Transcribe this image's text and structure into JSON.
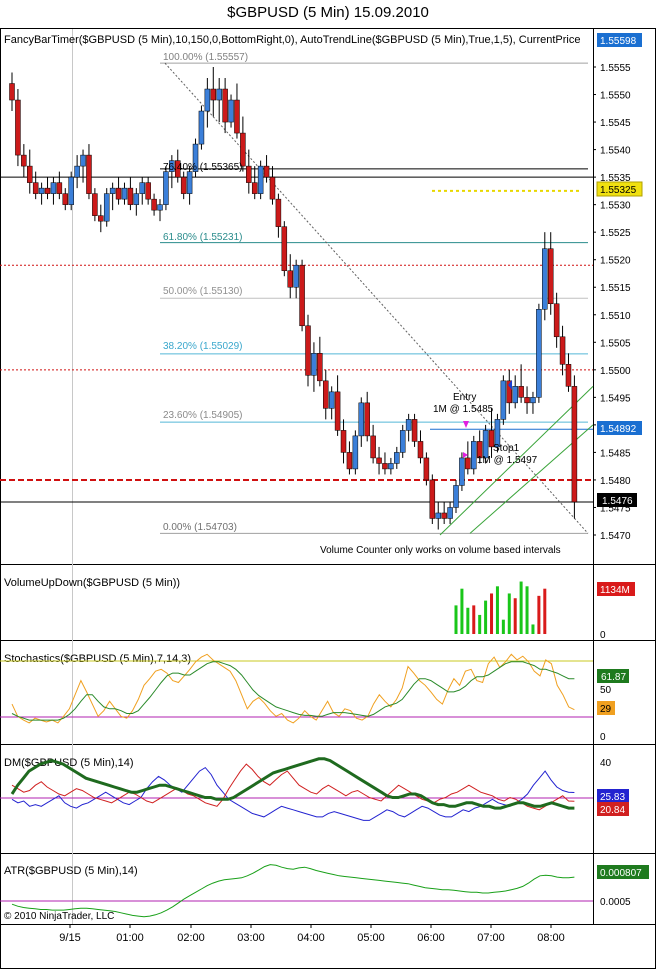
{
  "window": {
    "title": "$GBPUSD (5 Min)  15.09.2010"
  },
  "colors": {
    "up_candle": "#3b7fd9",
    "down_candle": "#cc1a1a",
    "wick": "#000000",
    "fib_gray": "#a0a0a0",
    "fib_teal": "#2a8c8c",
    "fib_blue": "#55b6d6",
    "red_level": "#d01010",
    "current_price_box": "#1a6fd1",
    "stop_box": "#000000",
    "target_box": "#f0e010",
    "volume_up": "#19c619",
    "volume_down": "#d91a1a",
    "stoch_k": "#f0a020",
    "stoch_d": "#2a8a2a",
    "dm_plus": "#2323d0",
    "dm_minus": "#d02020",
    "adx": "#1f7a1f",
    "atr": "#19a019"
  },
  "panels": {
    "price": {
      "header": "FancyBarTimer($GBPUSD (5 Min),10,150,0,BottomRight,0), AutoTrendLine($GBPUSD (5 Min),True,1,5), CurrentPrice",
      "yticks": [
        "1.5555",
        "1.5550",
        "1.5545",
        "1.5540",
        "1.5535",
        "1.5530",
        "1.5525",
        "1.5520",
        "1.5515",
        "1.5510",
        "1.5505",
        "1.5500",
        "1.5495",
        "1.5490",
        "1.5485",
        "1.5480",
        "1.5475",
        "1.5470"
      ],
      "fib_labels": [
        "100.00% (1.55557)",
        "76.40% (1.55365)",
        "61.80% (1.55231)",
        "50.00% (1.55130)",
        "38.20% (1.55029)",
        "23.60% (1.54905)",
        "0.00% (1.54703)"
      ],
      "price_boxes": [
        "1.55598",
        "1.55325",
        "1.54892",
        "1.5476"
      ],
      "entry_label": "Entry",
      "entry_detail": "1M @ 1.5485",
      "stop_label": "Stop1",
      "stop_detail": "1M @ 1.5497",
      "volume_note": "Volume Counter only works on volume based intervals"
    },
    "volume": {
      "header": "VolumeUpDown($GBPUSD (5 Min))",
      "box": "1134M",
      "yticks": [
        "0"
      ]
    },
    "stochastics": {
      "header": "Stochastics($GBPUSD (5 Min),7,14,3)",
      "box_d": "61.87",
      "box_k": "29",
      "yticks": [
        "50",
        "0"
      ]
    },
    "dm": {
      "header": "DM($GBPUSD (5 Min),14)",
      "box_plus": "25.83",
      "box_minus": "20.84",
      "yticks": [
        "40",
        "20"
      ]
    },
    "atr": {
      "header": "ATR($GBPUSD (5 Min),14)",
      "box": "0.000807",
      "yticks": [
        "0.0005"
      ],
      "copyright": "© 2010 NinjaTrader, LLC"
    }
  },
  "x_axis": {
    "labels": [
      "9/15",
      "01:00",
      "02:00",
      "03:00",
      "04:00",
      "05:00",
      "06:00",
      "07:00",
      "08:00"
    ]
  },
  "chart_data": {
    "type": "candlestick",
    "title": "$GBPUSD (5 Min)  15.09.2010",
    "x": [
      "9/15",
      "01:00",
      "02:00",
      "03:00",
      "04:00",
      "05:00",
      "06:00",
      "07:00",
      "08:00"
    ],
    "ylim": [
      1.5467,
      1.556
    ],
    "grid": false,
    "candles": [
      [
        1.5552,
        1.5554,
        1.5547,
        1.5549
      ],
      [
        1.5549,
        1.5551,
        1.5537,
        1.5539
      ],
      [
        1.5539,
        1.5541,
        1.5535,
        1.5537
      ],
      [
        1.5537,
        1.554,
        1.5532,
        1.5534
      ],
      [
        1.5534,
        1.5536,
        1.5531,
        1.5532
      ],
      [
        1.5532,
        1.5534,
        1.553,
        1.5533
      ],
      [
        1.5533,
        1.5535,
        1.5531,
        1.5532
      ],
      [
        1.5532,
        1.5535,
        1.553,
        1.5534
      ],
      [
        1.5534,
        1.5536,
        1.5531,
        1.5532
      ],
      [
        1.5532,
        1.5533,
        1.5529,
        1.553
      ],
      [
        1.553,
        1.5536,
        1.5529,
        1.5535
      ],
      [
        1.5535,
        1.5539,
        1.5533,
        1.5537
      ],
      [
        1.5537,
        1.554,
        1.5534,
        1.5539
      ],
      [
        1.5539,
        1.5541,
        1.5531,
        1.5532
      ],
      [
        1.5532,
        1.5533,
        1.5527,
        1.5528
      ],
      [
        1.5528,
        1.553,
        1.5525,
        1.5527
      ],
      [
        1.5527,
        1.5533,
        1.5526,
        1.5532
      ],
      [
        1.5532,
        1.5534,
        1.5529,
        1.5533
      ],
      [
        1.5533,
        1.5535,
        1.553,
        1.5531
      ],
      [
        1.5531,
        1.5534,
        1.553,
        1.5533
      ],
      [
        1.5533,
        1.5535,
        1.5529,
        1.553
      ],
      [
        1.553,
        1.5533,
        1.5528,
        1.5532
      ],
      [
        1.5532,
        1.5535,
        1.553,
        1.5534
      ],
      [
        1.5534,
        1.5535,
        1.553,
        1.5531
      ],
      [
        1.5531,
        1.5532,
        1.5528,
        1.5529
      ],
      [
        1.5529,
        1.5531,
        1.5527,
        1.553
      ],
      [
        1.553,
        1.5537,
        1.5529,
        1.5536
      ],
      [
        1.5536,
        1.5539,
        1.5533,
        1.5538
      ],
      [
        1.5538,
        1.554,
        1.5534,
        1.5535
      ],
      [
        1.5535,
        1.5536,
        1.5531,
        1.5532
      ],
      [
        1.5532,
        1.5537,
        1.553,
        1.5536
      ],
      [
        1.5536,
        1.5542,
        1.5535,
        1.5541
      ],
      [
        1.5541,
        1.5548,
        1.554,
        1.5547
      ],
      [
        1.5547,
        1.5553,
        1.5544,
        1.5551
      ],
      [
        1.5551,
        1.5555,
        1.5546,
        1.5549
      ],
      [
        1.5549,
        1.5553,
        1.5545,
        1.5551
      ],
      [
        1.5551,
        1.5553,
        1.5543,
        1.5545
      ],
      [
        1.5545,
        1.555,
        1.5544,
        1.5549
      ],
      [
        1.5549,
        1.5552,
        1.5542,
        1.5543
      ],
      [
        1.5543,
        1.5546,
        1.5536,
        1.5537
      ],
      [
        1.5537,
        1.554,
        1.5532,
        1.5534
      ],
      [
        1.5534,
        1.5537,
        1.5531,
        1.5532
      ],
      [
        1.5532,
        1.5538,
        1.5531,
        1.5537
      ],
      [
        1.5537,
        1.5539,
        1.5534,
        1.5535
      ],
      [
        1.5535,
        1.5537,
        1.553,
        1.5531
      ],
      [
        1.5531,
        1.5532,
        1.5524,
        1.5526
      ],
      [
        1.5526,
        1.5527,
        1.5517,
        1.5518
      ],
      [
        1.5518,
        1.5521,
        1.5513,
        1.5515
      ],
      [
        1.5515,
        1.552,
        1.5513,
        1.5519
      ],
      [
        1.5519,
        1.552,
        1.5507,
        1.5508
      ],
      [
        1.5508,
        1.551,
        1.5497,
        1.5499
      ],
      [
        1.5499,
        1.5505,
        1.5496,
        1.5503
      ],
      [
        1.5503,
        1.5506,
        1.5497,
        1.5498
      ],
      [
        1.5498,
        1.55,
        1.5491,
        1.5493
      ],
      [
        1.5493,
        1.5497,
        1.5491,
        1.5496
      ],
      [
        1.5496,
        1.5499,
        1.5488,
        1.5489
      ],
      [
        1.5489,
        1.5491,
        1.5483,
        1.5485
      ],
      [
        1.5485,
        1.5487,
        1.5481,
        1.5482
      ],
      [
        1.5482,
        1.5489,
        1.5481,
        1.5488
      ],
      [
        1.5488,
        1.5495,
        1.5486,
        1.5494
      ],
      [
        1.5494,
        1.5496,
        1.5487,
        1.5488
      ],
      [
        1.5488,
        1.549,
        1.5483,
        1.5484
      ],
      [
        1.5484,
        1.5486,
        1.5481,
        1.5483
      ],
      [
        1.5483,
        1.5485,
        1.5481,
        1.5482
      ],
      [
        1.5482,
        1.5484,
        1.5481,
        1.5483
      ],
      [
        1.5483,
        1.5486,
        1.5482,
        1.5485
      ],
      [
        1.5485,
        1.549,
        1.5484,
        1.5489
      ],
      [
        1.5489,
        1.5492,
        1.5487,
        1.5491
      ],
      [
        1.5491,
        1.5492,
        1.5486,
        1.5487
      ],
      [
        1.5487,
        1.5489,
        1.5483,
        1.5484
      ],
      [
        1.5484,
        1.5485,
        1.5479,
        1.548
      ],
      [
        1.548,
        1.5481,
        1.5472,
        1.5473
      ],
      [
        1.5473,
        1.5476,
        1.5471,
        1.5474
      ],
      [
        1.5474,
        1.5476,
        1.5472,
        1.5473
      ],
      [
        1.5473,
        1.5476,
        1.5472,
        1.5475
      ],
      [
        1.5475,
        1.548,
        1.5474,
        1.5479
      ],
      [
        1.5479,
        1.5485,
        1.5478,
        1.5484
      ],
      [
        1.5484,
        1.5487,
        1.5481,
        1.5482
      ],
      [
        1.5482,
        1.5488,
        1.5481,
        1.5487
      ],
      [
        1.5487,
        1.5489,
        1.5483,
        1.5484
      ],
      [
        1.5484,
        1.549,
        1.5483,
        1.5489
      ],
      [
        1.5489,
        1.5493,
        1.5484,
        1.5486
      ],
      [
        1.5486,
        1.5492,
        1.5485,
        1.5491
      ],
      [
        1.5491,
        1.5499,
        1.549,
        1.5498
      ],
      [
        1.5498,
        1.55,
        1.5492,
        1.5494
      ],
      [
        1.5494,
        1.5499,
        1.5493,
        1.5497
      ],
      [
        1.5497,
        1.5501,
        1.5494,
        1.5495
      ],
      [
        1.5495,
        1.5497,
        1.5492,
        1.5494
      ],
      [
        1.5494,
        1.5496,
        1.5492,
        1.5495
      ],
      [
        1.5495,
        1.5512,
        1.5494,
        1.5511
      ],
      [
        1.5511,
        1.5525,
        1.5509,
        1.5522
      ],
      [
        1.5522,
        1.5525,
        1.551,
        1.5512
      ],
      [
        1.5512,
        1.5514,
        1.5504,
        1.5506
      ],
      [
        1.5506,
        1.5508,
        1.5499,
        1.5501
      ],
      [
        1.5501,
        1.5503,
        1.5496,
        1.5497
      ],
      [
        1.5497,
        1.5499,
        1.5473,
        1.5476
      ]
    ],
    "fib_levels": [
      {
        "label": "100.00% (1.55557)",
        "price": 1.55557
      },
      {
        "label": "76.40% (1.55365)",
        "price": 1.55365
      },
      {
        "label": "61.80% (1.55231)",
        "price": 1.55231
      },
      {
        "label": "50.00% (1.55130)",
        "price": 1.5513
      },
      {
        "label": "38.20% (1.55029)",
        "price": 1.55029
      },
      {
        "label": "23.60% (1.54905)",
        "price": 1.54905
      },
      {
        "label": "0.00% (1.54703)",
        "price": 1.54703
      }
    ],
    "horizontal_levels": {
      "red_dotted": [
        1.5519,
        1.55
      ],
      "red_dashed": 1.548,
      "black_solid": [
        1.5535,
        1.5476
      ],
      "yellow_dotted": 1.55325,
      "entry": 1.54892
    },
    "volume": {
      "start_index": 75,
      "up": [
        60,
        95,
        55,
        0,
        40,
        70,
        0,
        100,
        30,
        85,
        0,
        110,
        100,
        20,
        0,
        0
      ],
      "down": [
        0,
        0,
        0,
        60,
        0,
        0,
        85,
        0,
        45,
        0,
        75,
        0,
        0,
        90,
        80,
        95
      ],
      "ylim": [
        0,
        130
      ]
    },
    "stochastics": {
      "ylim": [
        0,
        100
      ],
      "levels": [
        80,
        20
      ],
      "k": [
        35,
        22,
        18,
        15,
        20,
        18,
        16,
        18,
        15,
        22,
        30,
        45,
        60,
        48,
        35,
        22,
        28,
        38,
        30,
        22,
        20,
        28,
        40,
        55,
        62,
        70,
        72,
        68,
        60,
        58,
        65,
        72,
        80,
        85,
        88,
        82,
        78,
        74,
        70,
        60,
        45,
        30,
        38,
        42,
        36,
        28,
        22,
        25,
        18,
        15,
        20,
        28,
        22,
        18,
        28,
        38,
        26,
        22,
        30,
        28,
        20,
        18,
        22,
        35,
        45,
        38,
        32,
        40,
        52,
        75,
        68,
        60,
        55,
        48,
        40,
        35,
        50,
        62,
        55,
        70,
        72,
        60,
        58,
        78,
        85,
        74,
        80,
        88,
        82,
        86,
        80,
        70,
        65,
        82,
        78,
        55,
        45,
        32,
        29
      ],
      "d": [
        25,
        22,
        20,
        18,
        18,
        18,
        18,
        18,
        18,
        20,
        24,
        30,
        38,
        45,
        45,
        38,
        32,
        30,
        30,
        28,
        25,
        25,
        28,
        35,
        42,
        50,
        58,
        65,
        68,
        68,
        66,
        66,
        70,
        74,
        78,
        80,
        80,
        78,
        76,
        72,
        66,
        58,
        50,
        44,
        40,
        36,
        32,
        30,
        28,
        26,
        24,
        23,
        23,
        22,
        22,
        24,
        26,
        26,
        26,
        25,
        24,
        23,
        22,
        24,
        28,
        32,
        34,
        36,
        40,
        48,
        56,
        62,
        62,
        60,
        56,
        52,
        48,
        48,
        50,
        54,
        60,
        64,
        64,
        66,
        70,
        74,
        78,
        80,
        80,
        80,
        78,
        76,
        72,
        72,
        70,
        68,
        65,
        62,
        61.87
      ]
    },
    "dm": {
      "ylim": [
        0,
        50
      ],
      "level": 25,
      "plus": [
        22,
        20,
        21,
        18,
        19,
        18,
        20,
        22,
        24,
        20,
        18,
        17,
        19,
        20,
        22,
        24,
        26,
        24,
        22,
        20,
        19,
        21,
        23,
        28,
        32,
        35,
        33,
        30,
        28,
        26,
        30,
        34,
        38,
        40,
        36,
        30,
        26,
        22,
        20,
        18,
        16,
        14,
        13,
        12,
        14,
        16,
        18,
        17,
        16,
        15,
        14,
        13,
        12,
        12,
        14,
        15,
        14,
        13,
        12,
        11,
        10,
        10,
        12,
        14,
        16,
        15,
        13,
        12,
        14,
        16,
        18,
        17,
        15,
        13,
        12,
        12,
        14,
        16,
        15,
        17,
        18,
        20,
        22,
        20,
        19,
        18,
        20,
        22,
        25,
        30,
        34,
        38,
        33,
        29,
        27,
        26,
        25.83
      ],
      "minus": [
        30,
        28,
        26,
        27,
        30,
        32,
        29,
        27,
        25,
        24,
        26,
        28,
        27,
        25,
        23,
        22,
        21,
        20,
        22,
        24,
        26,
        25,
        23,
        21,
        20,
        22,
        24,
        26,
        28,
        27,
        25,
        24,
        22,
        20,
        19,
        18,
        22,
        28,
        33,
        38,
        42,
        39,
        35,
        32,
        30,
        33,
        36,
        38,
        34,
        30,
        28,
        26,
        25,
        28,
        30,
        28,
        26,
        24,
        26,
        27,
        25,
        23,
        22,
        21,
        24,
        27,
        30,
        28,
        26,
        24,
        22,
        21,
        20,
        22,
        23,
        25,
        26,
        28,
        30,
        28,
        26,
        25,
        24,
        22,
        21,
        23,
        22,
        20,
        18,
        17,
        16,
        18,
        20,
        22,
        24,
        21,
        20.84
      ],
      "adx": [
        25,
        30,
        34,
        38,
        40,
        42,
        43,
        44,
        43,
        42,
        40,
        38,
        36,
        34,
        33,
        32,
        31,
        30,
        29,
        28,
        27,
        26,
        26,
        27,
        28,
        29,
        30,
        30,
        29,
        28,
        27,
        26,
        25,
        24,
        23,
        23,
        22,
        22,
        22,
        23,
        25,
        27,
        29,
        31,
        33,
        35,
        37,
        38,
        39,
        40,
        41,
        42,
        43,
        44,
        45,
        45,
        44,
        42,
        40,
        38,
        36,
        34,
        32,
        30,
        28,
        26,
        24,
        23,
        23,
        24,
        25,
        25,
        24,
        22,
        20,
        19,
        19,
        18,
        18,
        19,
        20,
        20,
        19,
        18,
        18,
        17,
        17,
        18,
        19,
        20,
        20,
        19,
        18,
        18,
        19,
        20,
        19,
        18,
        17,
        17
      ]
    },
    "atr": {
      "ylim": [
        0.0001,
        0.0011
      ],
      "level": 0.0005,
      "values": [
        0.0004,
        0.00037,
        0.00035,
        0.00034,
        0.00033,
        0.00032,
        0.00032,
        0.00031,
        0.00031,
        0.00031,
        0.00032,
        0.00033,
        0.00034,
        0.00034,
        0.00033,
        0.00032,
        0.00031,
        0.0003,
        0.00029,
        0.00027,
        0.00025,
        0.00023,
        0.00022,
        0.00021,
        0.00022,
        0.00024,
        0.00027,
        0.00031,
        0.00036,
        0.00042,
        0.00048,
        0.00053,
        0.00058,
        0.00063,
        0.00068,
        0.00072,
        0.00075,
        0.00077,
        0.00078,
        0.00079,
        0.0008,
        0.00083,
        0.00087,
        0.00092,
        0.00097,
        0.001,
        0.00099,
        0.00096,
        0.00094,
        0.00093,
        0.00095,
        0.00096,
        0.00094,
        0.00091,
        0.00089,
        0.00087,
        0.00085,
        0.00083,
        0.00082,
        0.00081,
        0.0008,
        0.00079,
        0.00078,
        0.00077,
        0.00076,
        0.00075,
        0.00074,
        0.00073,
        0.00072,
        0.00071,
        0.00069,
        0.00067,
        0.00065,
        0.00064,
        0.00063,
        0.00062,
        0.00062,
        0.00061,
        0.0006,
        0.00059,
        0.00058,
        0.00058,
        0.00057,
        0.00057,
        0.00058,
        0.00059,
        0.0006,
        0.00062,
        0.00064,
        0.00067,
        0.00072,
        0.00078,
        0.00083,
        0.00084,
        0.00083,
        0.00081,
        0.0008,
        0.0008,
        0.00081
      ]
    }
  }
}
